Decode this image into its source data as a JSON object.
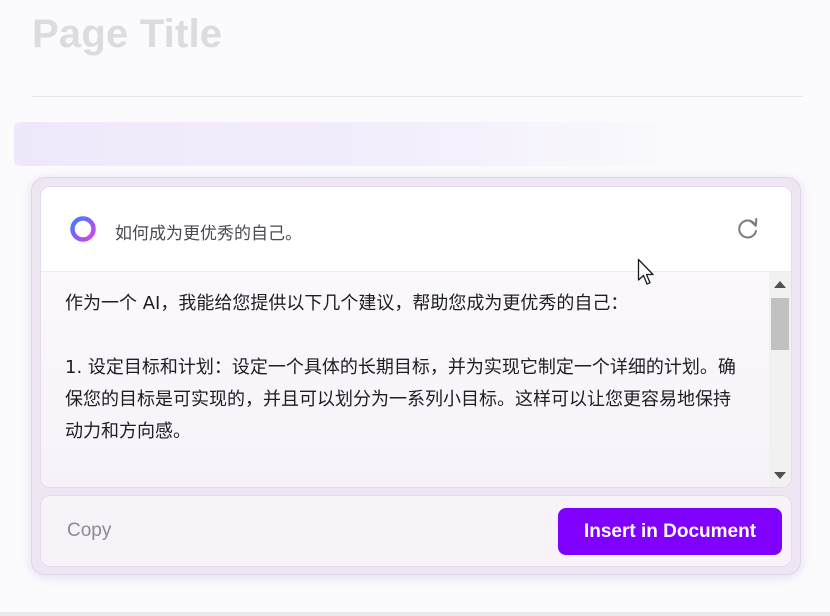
{
  "page": {
    "title": "Page Title"
  },
  "ai_panel": {
    "prompt": "如何成为更优秀的自己。",
    "icons": {
      "assistant": "ai-ring-icon",
      "regenerate": "regenerate-icon"
    },
    "response_paragraphs": [
      "作为一个 AI，我能给您提供以下几个建议，帮助您成为更优秀的自己：",
      "1. 设定目标和计划：设定一个具体的长期目标，并为实现它制定一个详细的计划。确保您的目标是可实现的，并且可以划分为一系列小目标。这样可以让您更容易地保持动力和方向感。"
    ],
    "actions": {
      "copy_label": "Copy",
      "insert_label": "Insert in Document"
    }
  },
  "colors": {
    "accent": "#7f00ff",
    "ring_gradient_start": "#3b82f6",
    "ring_gradient_end": "#c026d3"
  }
}
